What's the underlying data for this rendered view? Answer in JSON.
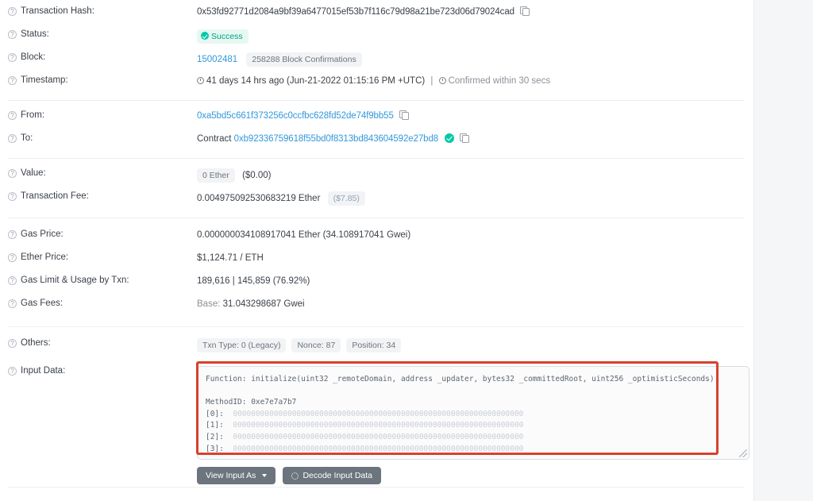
{
  "transaction": {
    "rows": [
      {
        "key": "hash",
        "label": "Transaction Hash:",
        "value": "0x53fd92771d2084a9bf39a6477015ef53b7f116c79d98a21be723d06d79024cad"
      },
      {
        "key": "status",
        "label": "Status:",
        "value": "Success"
      },
      {
        "key": "block",
        "label": "Block:",
        "value": "15002481",
        "confirmations": "258288 Block Confirmations"
      },
      {
        "key": "timestamp",
        "label": "Timestamp:",
        "value": "41 days 14 hrs ago (Jun-21-2022 01:15:16 PM +UTC)",
        "confirmed_within": "Confirmed within 30 secs",
        "separator": "|"
      },
      {
        "key": "from",
        "label": "From:",
        "value": "0xa5bd5c661f373256c0ccfbc628fd52de74f9bb55"
      },
      {
        "key": "to",
        "label": "To:",
        "prefix": "Contract",
        "value": "0xb92336759618f55bd0f8313bd843604592e27bd8"
      },
      {
        "key": "value",
        "label": "Value:",
        "value": "0 Ether",
        "usd": "($0.00)"
      },
      {
        "key": "fee",
        "label": "Transaction Fee:",
        "value": "0.004975092530683219 Ether",
        "usd": "($7.85)"
      },
      {
        "key": "gasprice",
        "label": "Gas Price:",
        "value": "0.000000034108917041 Ether (34.108917041 Gwei)"
      },
      {
        "key": "etherprice",
        "label": "Ether Price:",
        "value": "$1,124.71 / ETH"
      },
      {
        "key": "gaslimit",
        "label": "Gas Limit & Usage by Txn:",
        "value": "189,616   |   145,859 (76.92%)"
      },
      {
        "key": "gasfees",
        "label": "Gas Fees:",
        "prefix": "Base:",
        "value": "31.043298687 Gwei"
      },
      {
        "key": "others",
        "label": "Others:"
      },
      {
        "key": "inputdata",
        "label": "Input Data:"
      }
    ],
    "others_badges": [
      "Txn Type: 0 (Legacy)",
      "Nonce: 87",
      "Position: 34"
    ],
    "input_data": {
      "function_line": "Function: initialize(uint32 _remoteDomain, address _updater, bytes32 _committedRoot, uint256 _optimisticSeconds)",
      "method_id_label": "MethodID: 0xe7e7a7b7",
      "params": [
        {
          "index": "[0]:",
          "hex": "0000000000000000000000000000000000000000000000000000000000000000"
        },
        {
          "index": "[1]:",
          "hex": "0000000000000000000000000000000000000000000000000000000000000000"
        },
        {
          "index": "[2]:",
          "hex": "0000000000000000000000000000000000000000000000000000000000000000"
        },
        {
          "index": "[3]:",
          "hex": "0000000000000000000000000000000000000000000000000000000000000000"
        }
      ]
    },
    "buttons": {
      "view_input_as": "View Input As",
      "decode_input_data": "Decode Input Data"
    }
  },
  "colors": {
    "link": "#3498db",
    "success": "#00a186",
    "annotation": "#d8402f",
    "button": "#6c757d"
  }
}
